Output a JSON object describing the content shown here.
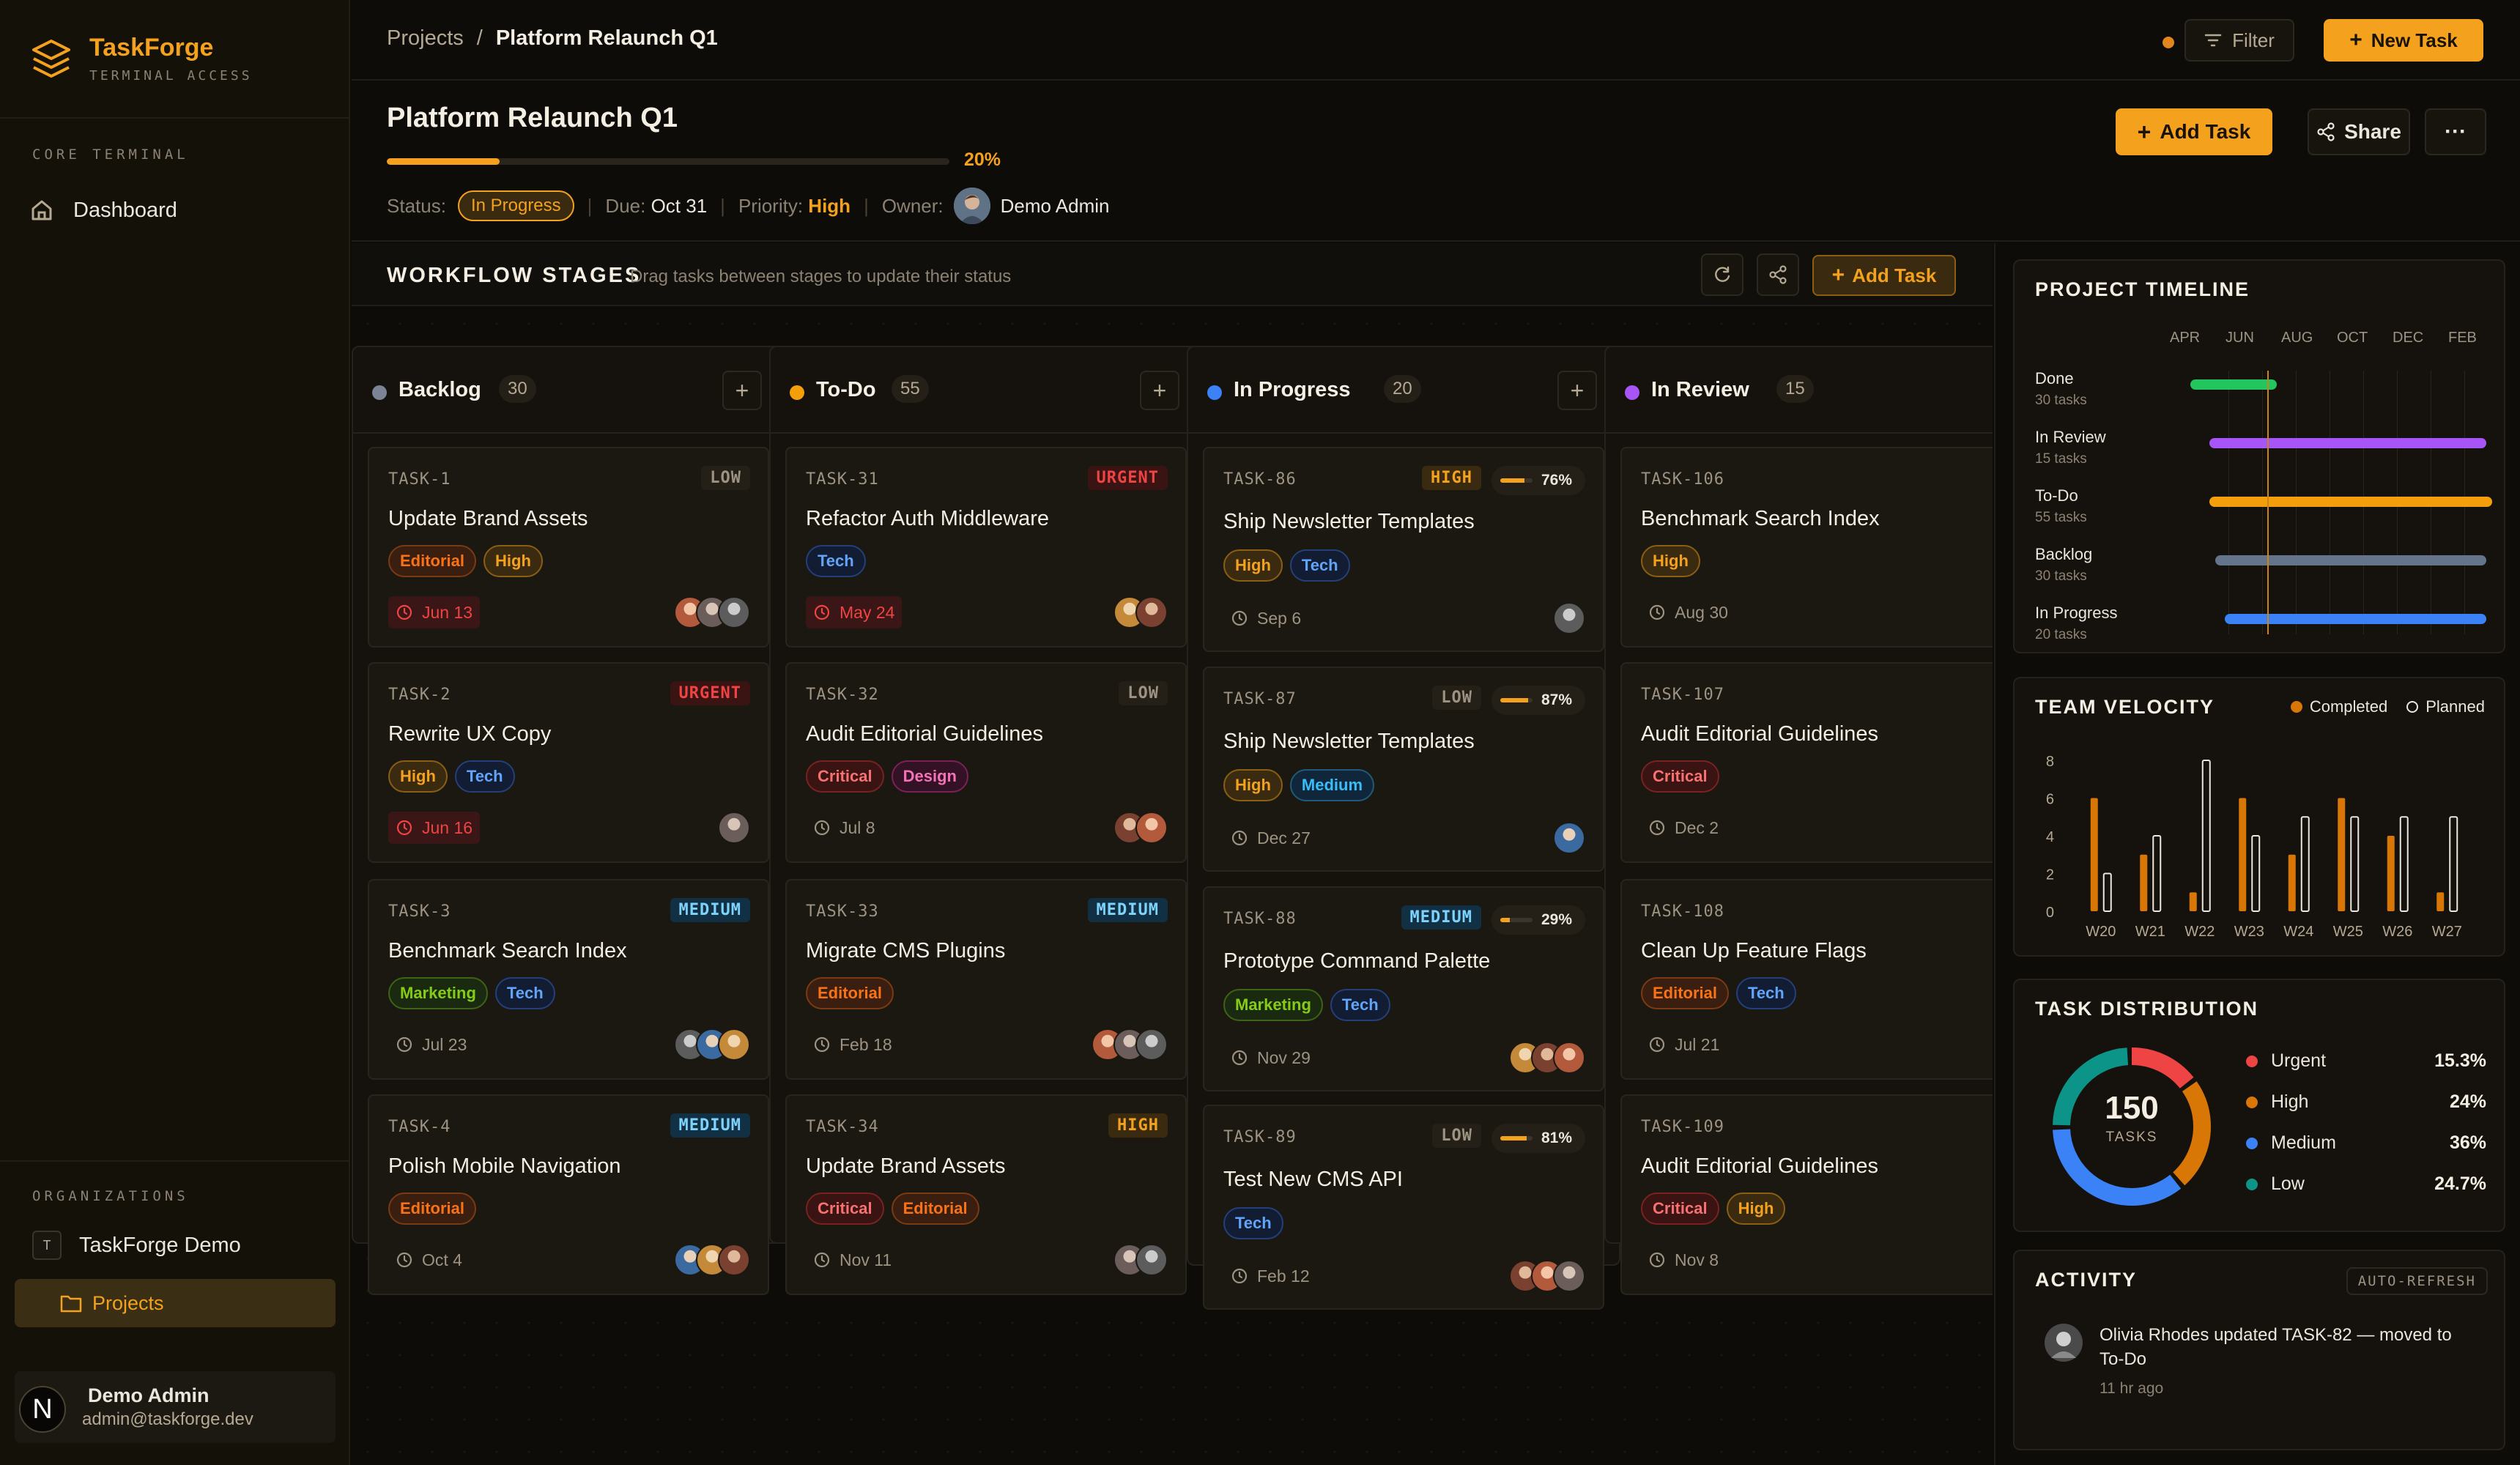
{
  "brand": {
    "name": "TaskForge",
    "subtitle": "TERMINAL ACCESS"
  },
  "sidebar": {
    "section_label": "CORE TERMINAL",
    "items": [
      {
        "label": "Dashboard",
        "icon": "home-icon"
      }
    ],
    "org_section_label": "ORGANIZATIONS",
    "org": {
      "badge": "T",
      "name": "TaskForge Demo"
    },
    "org_items": [
      {
        "label": "Projects",
        "icon": "folder-icon",
        "active": true
      }
    ],
    "user": {
      "initial": "N",
      "name": "Demo Admin",
      "email": "admin@taskforge.dev"
    }
  },
  "topbar": {
    "breadcrumb": [
      "Projects",
      "Platform Relaunch Q1"
    ],
    "filter_label": "Filter",
    "new_task_label": "New Task"
  },
  "project": {
    "title": "Platform Relaunch Q1",
    "progress": 20,
    "progress_label": "20%",
    "status_label": "Status:",
    "status": "In Progress",
    "due_label": "Due:",
    "due": "Oct 31",
    "priority_label": "Priority:",
    "priority": "High",
    "owner_label": "Owner:",
    "owner": "Demo Admin",
    "add_task_label": "Add Task",
    "share_label": "Share"
  },
  "workflow": {
    "title": "WORKFLOW STAGES",
    "subtitle": "Drag tasks between stages to update their status",
    "add_task_label": "Add Task"
  },
  "columns": [
    {
      "name": "Backlog",
      "count": "30",
      "color": "#7b8494",
      "cards": [
        {
          "id": "TASK-1",
          "priority": "LOW",
          "title": "Update Brand Assets",
          "tags": [
            "Editorial",
            "High"
          ],
          "due": "Jun 13",
          "overdue": true,
          "avatars": 3
        },
        {
          "id": "TASK-2",
          "priority": "URGENT",
          "title": "Rewrite UX Copy",
          "tags": [
            "High",
            "Tech"
          ],
          "due": "Jun 16",
          "overdue": true,
          "avatars": 1
        },
        {
          "id": "TASK-3",
          "priority": "MEDIUM",
          "title": "Benchmark Search Index",
          "tags": [
            "Marketing",
            "Tech"
          ],
          "due": "Jul 23",
          "overdue": false,
          "avatars": 3
        },
        {
          "id": "TASK-4",
          "priority": "MEDIUM",
          "title": "Polish Mobile Navigation",
          "tags": [
            "Editorial"
          ],
          "due": "Oct 4",
          "overdue": false,
          "avatars": 3
        }
      ]
    },
    {
      "name": "To-Do",
      "count": "55",
      "color": "#f59e0b",
      "cards": [
        {
          "id": "TASK-31",
          "priority": "URGENT",
          "title": "Refactor Auth Middleware",
          "tags": [
            "Tech"
          ],
          "due": "May 24",
          "overdue": true,
          "avatars": 2
        },
        {
          "id": "TASK-32",
          "priority": "LOW",
          "title": "Audit Editorial Guidelines",
          "tags": [
            "Critical",
            "Design"
          ],
          "due": "Jul 8",
          "overdue": false,
          "avatars": 2
        },
        {
          "id": "TASK-33",
          "priority": "MEDIUM",
          "title": "Migrate CMS Plugins",
          "tags": [
            "Editorial"
          ],
          "due": "Feb 18",
          "overdue": false,
          "avatars": 3
        },
        {
          "id": "TASK-34",
          "priority": "HIGH",
          "title": "Update Brand Assets",
          "tags": [
            "Critical",
            "Editorial"
          ],
          "due": "Nov 11",
          "overdue": false,
          "avatars": 2
        }
      ]
    },
    {
      "name": "In Progress",
      "count": "20",
      "color": "#3b82f6",
      "cards": [
        {
          "id": "TASK-86",
          "priority": "HIGH",
          "progress": 76,
          "progress_label": "76%",
          "title": "Ship Newsletter Templates",
          "tags": [
            "High",
            "Tech"
          ],
          "due": "Sep 6",
          "overdue": false,
          "avatars": 1
        },
        {
          "id": "TASK-87",
          "priority": "LOW",
          "progress": 87,
          "progress_label": "87%",
          "title": "Ship Newsletter Templates",
          "tags": [
            "High",
            "Medium"
          ],
          "due": "Dec 27",
          "overdue": false,
          "avatars": 1
        },
        {
          "id": "TASK-88",
          "priority": "MEDIUM",
          "progress": 29,
          "progress_label": "29%",
          "title": "Prototype Command Palette",
          "tags": [
            "Marketing",
            "Tech"
          ],
          "due": "Nov 29",
          "overdue": false,
          "avatars": 3
        },
        {
          "id": "TASK-89",
          "priority": "LOW",
          "progress": 81,
          "progress_label": "81%",
          "title": "Test New CMS API",
          "tags": [
            "Tech"
          ],
          "due": "Feb 12",
          "overdue": false,
          "avatars": 3
        }
      ]
    },
    {
      "name": "In Review",
      "count": "15",
      "color": "#a855f7",
      "cards": [
        {
          "id": "TASK-106",
          "priority": "",
          "title": "Benchmark Search Index",
          "tags": [
            "High"
          ],
          "due": "Aug 30",
          "overdue": false,
          "avatars": 0
        },
        {
          "id": "TASK-107",
          "priority": "",
          "title": "Audit Editorial Guidelines",
          "tags": [
            "Critical"
          ],
          "due": "Dec 2",
          "overdue": false,
          "avatars": 0
        },
        {
          "id": "TASK-108",
          "priority": "",
          "title": "Clean Up Feature Flags",
          "tags": [
            "Editorial",
            "Tech"
          ],
          "due": "Jul 21",
          "overdue": false,
          "avatars": 0
        },
        {
          "id": "TASK-109",
          "priority": "",
          "title": "Audit Editorial Guidelines",
          "tags": [
            "Critical",
            "High"
          ],
          "due": "Nov 8",
          "overdue": false,
          "avatars": 0
        }
      ]
    }
  ],
  "timeline": {
    "title": "PROJECT TIMELINE",
    "months": [
      "APR",
      "JUN",
      "AUG",
      "OCT",
      "DEC",
      "FEB"
    ],
    "rows": [
      {
        "name": "Done",
        "sub": "30 tasks",
        "color": "#22c55e",
        "start": 0.02,
        "end": 0.3
      },
      {
        "name": "In Review",
        "sub": "15 tasks",
        "color": "#a855f7",
        "start": 0.08,
        "end": 0.98
      },
      {
        "name": "To-Do",
        "sub": "55 tasks",
        "color": "#f59e0b",
        "start": 0.08,
        "end": 1.0
      },
      {
        "name": "Backlog",
        "sub": "30 tasks",
        "color": "#64748b",
        "start": 0.1,
        "end": 0.98
      },
      {
        "name": "In Progress",
        "sub": "20 tasks",
        "color": "#3b82f6",
        "start": 0.13,
        "end": 0.98
      }
    ],
    "today": 0.27
  },
  "velocity": {
    "title": "TEAM VELOCITY",
    "legend_completed": "Completed",
    "legend_planned": "Planned",
    "chart_data": {
      "type": "bar",
      "categories": [
        "W20",
        "W21",
        "W22",
        "W23",
        "W24",
        "W25",
        "W26",
        "W27"
      ],
      "series": [
        {
          "name": "Completed",
          "values": [
            6,
            3,
            1,
            6,
            3,
            6,
            4,
            1
          ]
        },
        {
          "name": "Planned",
          "values": [
            2,
            4,
            8,
            4,
            5,
            5,
            5,
            5
          ]
        }
      ],
      "yticks": [
        "0",
        "2",
        "4",
        "6",
        "8"
      ],
      "ylim": [
        0,
        8
      ]
    }
  },
  "distribution": {
    "title": "TASK DISTRIBUTION",
    "total": "150",
    "total_label": "TASKS",
    "items": [
      {
        "name": "Urgent",
        "pct_label": "15.3%",
        "value": 15.3,
        "color": "#ef4444"
      },
      {
        "name": "High",
        "pct_label": "24%",
        "value": 24,
        "color": "#d97706"
      },
      {
        "name": "Medium",
        "pct_label": "36%",
        "value": 36,
        "color": "#3b82f6"
      },
      {
        "name": "Low",
        "pct_label": "24.7%",
        "value": 24.7,
        "color": "#0d9488"
      }
    ]
  },
  "activity": {
    "title": "ACTIVITY",
    "badge": "AUTO-REFRESH",
    "items": [
      {
        "text": "Olivia Rhodes updated TASK-82 — moved to To-Do",
        "time": "11 hr ago"
      }
    ]
  },
  "colors": {
    "accent": "#f4a21e",
    "bg": "#0e0c09",
    "panel": "#15120d"
  }
}
